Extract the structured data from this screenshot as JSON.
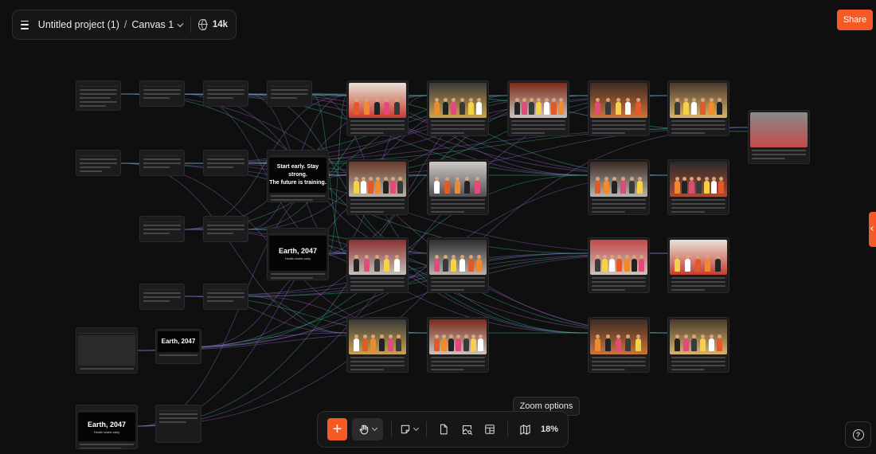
{
  "header": {
    "project_name": "Untitled project (1)",
    "separator": "/",
    "canvas_name": "Canvas 1",
    "globe_icon": "globe-icon",
    "count": "14k"
  },
  "share_label": "Share",
  "toolbar": {
    "add_icon": "+",
    "zoom_level": "18%",
    "tooltip": "Zoom options"
  },
  "help_icon": "?",
  "canvas_texts": {
    "slogan": "Start early. Stay strong.\nThe future is training.",
    "earth_title": "Earth, 2047",
    "earth_subtitle": "Health starts early"
  },
  "colors": {
    "accent": "#f45a25",
    "canvas_bg": "#0f0f0f",
    "node_bg": "#1c1c1e",
    "wire_green": "#3fbf9f",
    "wire_purple": "#9a6fd6"
  }
}
